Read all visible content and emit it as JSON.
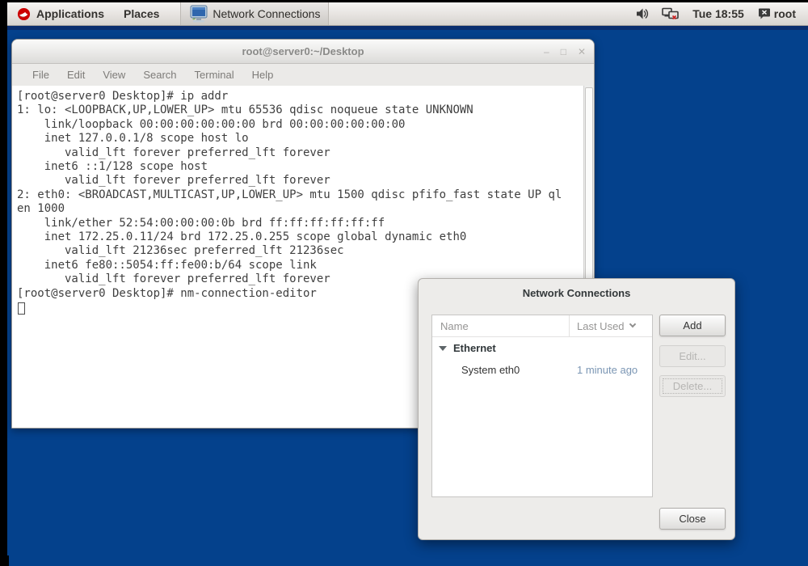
{
  "panel": {
    "applications_label": "Applications",
    "places_label": "Places",
    "task_button_label": "Network Connections",
    "clock": "Tue 18:55",
    "username": "root"
  },
  "terminal_window": {
    "title": "root@server0:~/Desktop",
    "menu": [
      "File",
      "Edit",
      "View",
      "Search",
      "Terminal",
      "Help"
    ],
    "output_lines": [
      "[root@server0 Desktop]# ip addr",
      "1: lo: <LOOPBACK,UP,LOWER_UP> mtu 65536 qdisc noqueue state UNKNOWN ",
      "    link/loopback 00:00:00:00:00:00 brd 00:00:00:00:00:00",
      "    inet 127.0.0.1/8 scope host lo",
      "       valid_lft forever preferred_lft forever",
      "    inet6 ::1/128 scope host ",
      "       valid_lft forever preferred_lft forever",
      "2: eth0: <BROADCAST,MULTICAST,UP,LOWER_UP> mtu 1500 qdisc pfifo_fast state UP ql",
      "en 1000",
      "    link/ether 52:54:00:00:00:0b brd ff:ff:ff:ff:ff:ff",
      "    inet 172.25.0.11/24 brd 172.25.0.255 scope global dynamic eth0",
      "       valid_lft 21236sec preferred_lft 21236sec",
      "    inet6 fe80::5054:ff:fe00:b/64 scope link ",
      "       valid_lft forever preferred_lft forever",
      "[root@server0 Desktop]# nm-connection-editor"
    ]
  },
  "network_dialog": {
    "title": "Network Connections",
    "name_column": "Name",
    "last_used_column": "Last Used",
    "group_label": "Ethernet",
    "rows": [
      {
        "name": "System eth0",
        "last_used": "1 minute ago"
      }
    ],
    "add_button": "Add",
    "edit_button": "Edit...",
    "delete_button": "Delete...",
    "close_button": "Close"
  },
  "icons": {
    "minimize": "‒",
    "maximize": "□",
    "close": "✕"
  },
  "colors": {
    "desktop_blue": "#04418c",
    "panel_gray": "#e8e5e2",
    "terminal_text": "#3f3f3f",
    "last_used_text": "#7b96b4",
    "accent_red": "#cc0000"
  }
}
